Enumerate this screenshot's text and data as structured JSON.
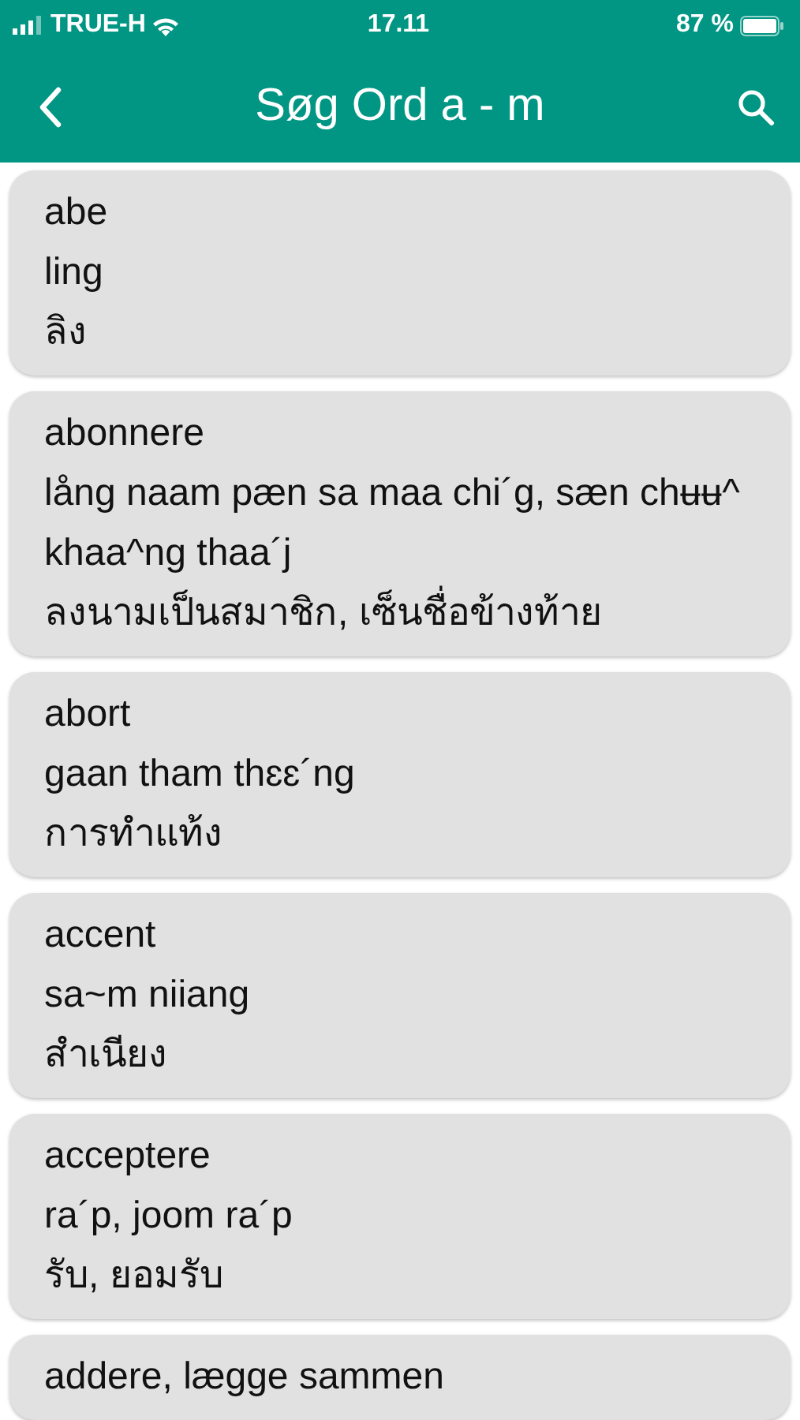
{
  "status_bar": {
    "carrier": "TRUE-H",
    "time": "17.11",
    "battery": "87 %"
  },
  "header": {
    "title": "Søg Ord a - m"
  },
  "entries": [
    {
      "lines": [
        "abe",
        "ling",
        "ลิง"
      ]
    },
    {
      "lines": [
        "abonnere",
        "lång naam pæn sa maa chi´g, sæn chʉʉ^ khaa^ng thaa´j",
        "ลงนามเป็นสมาชิก, เซ็นชื่อข้างท้าย"
      ]
    },
    {
      "lines": [
        "abort",
        "gaan tham thɛɛ´ng",
        "การทำแท้ง"
      ]
    },
    {
      "lines": [
        "accent",
        "sa~m niiang",
        "สำเนียง"
      ]
    },
    {
      "lines": [
        "acceptere",
        "ra´p, joom ra´p",
        "รับ, ยอมรับ"
      ]
    },
    {
      "lines": [
        "addere, lægge sammen"
      ]
    }
  ]
}
